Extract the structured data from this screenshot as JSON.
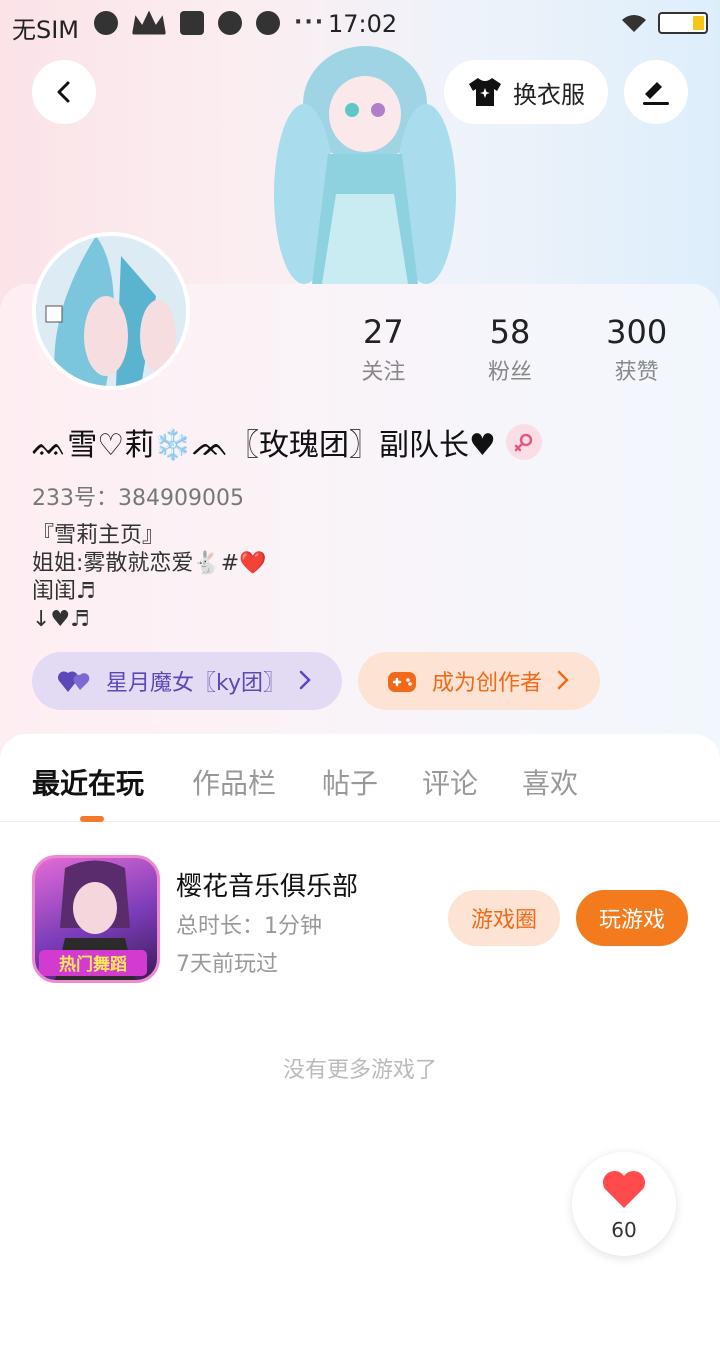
{
  "status_bar": {
    "carrier": "无SIM",
    "time": "17:02",
    "battery_level_percent": 25,
    "battery_color": "#f5c518"
  },
  "header": {
    "back_icon": "chevron-left-icon",
    "outfit_label": "换衣服",
    "outfit_icon": "tshirt-icon",
    "edit_icon": "pencil-icon"
  },
  "profile": {
    "stats": [
      {
        "value": "27",
        "label": "关注"
      },
      {
        "value": "58",
        "label": "粉丝"
      },
      {
        "value": "300",
        "label": "获赞"
      }
    ],
    "nickname": "ᨐ雪♡莉❄️ᨏ〖玫瑰团〗副队长♥",
    "gender_icon": "female-icon",
    "uid": "233号：384909005",
    "bio_lines": [
      "『雪莉主页』",
      "姐姐:雾散就恋爱🐇#❤️",
      "闺闺♬",
      "↓♥♬"
    ]
  },
  "pills": {
    "team_label": "星月魔女〖ky团〗",
    "team_icon": "hearts-icon",
    "team_color": "#5c48b8",
    "creator_label": "成为创作者",
    "creator_icon": "gamepad-icon",
    "creator_color": "#f06a1a"
  },
  "tabs": [
    "最近在玩",
    "作品栏",
    "帖子",
    "评论",
    "喜欢"
  ],
  "active_tab": "最近在玩",
  "accent_color": "#f47a1e",
  "games": [
    {
      "name": "樱花音乐俱乐部",
      "duration": "总时长：1分钟",
      "last_played": "7天前玩过",
      "circle_label": "游戏圈",
      "play_label": "玩游戏",
      "icon_caption": "热门舞蹈"
    }
  ],
  "no_more_text": "没有更多游戏了",
  "like": {
    "count": "60",
    "icon": "heart-icon"
  }
}
